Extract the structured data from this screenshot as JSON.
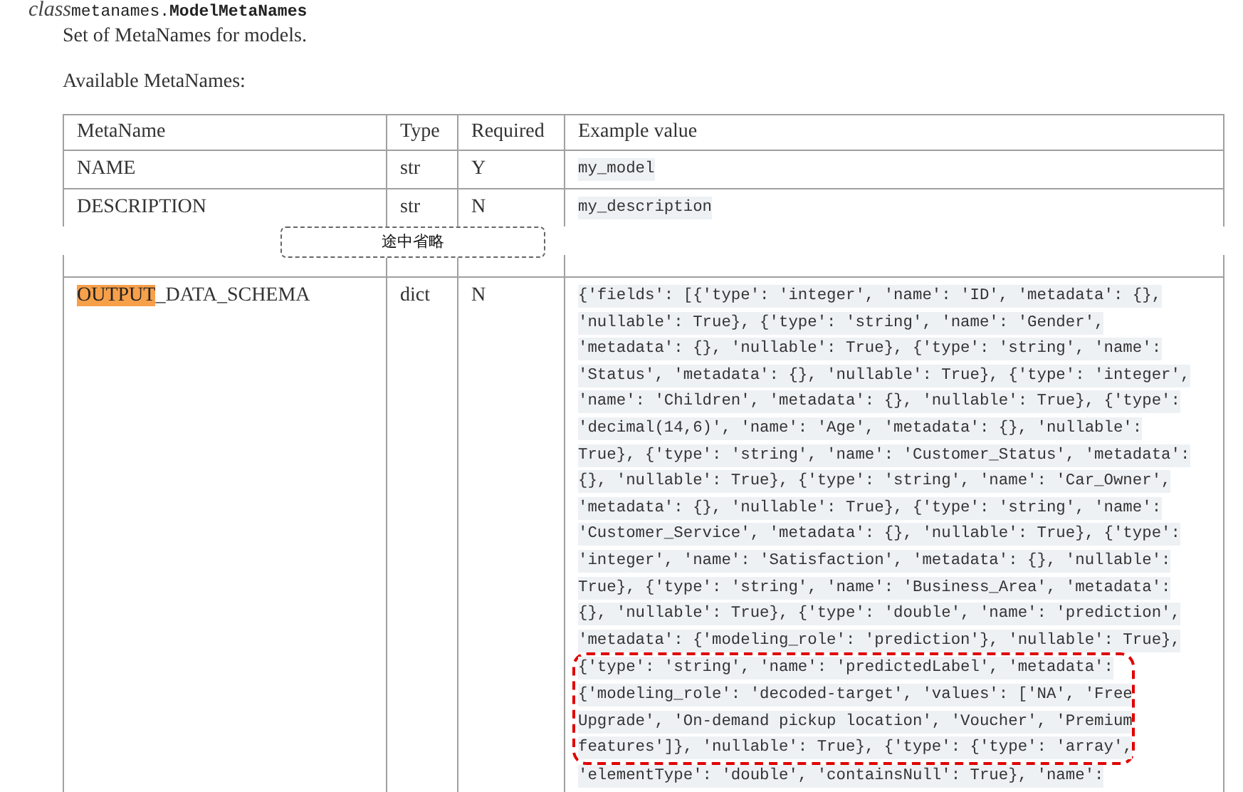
{
  "class_signature": {
    "keyword": "class",
    "module": "metanames.",
    "name": "ModelMetaNames"
  },
  "description": "Set of MetaNames for models.",
  "subheading": "Available MetaNames:",
  "table": {
    "columns": [
      "MetaName",
      "Type",
      "Required",
      "Example value"
    ],
    "rows": [
      {
        "metaname": [
          {
            "text": "NAME",
            "highlighted": false
          }
        ],
        "type": "str",
        "required": "Y",
        "example": [
          {
            "highlighted": false,
            "lines": [
              "my_model"
            ]
          }
        ]
      },
      {
        "metaname": [
          {
            "text": "DESCRIPTION",
            "highlighted": false
          }
        ],
        "type": "str",
        "required": "N",
        "example": [
          {
            "highlighted": false,
            "lines": [
              "my_description"
            ]
          }
        ]
      }
    ],
    "omission_label": "途中省略",
    "rows_after": [
      {
        "metaname": [
          {
            "text": "OUTPUT",
            "highlighted": true
          },
          {
            "text": "_DATA_SCHEMA",
            "highlighted": false
          }
        ],
        "type": "dict",
        "required": "N",
        "example": [
          {
            "highlighted": false,
            "lines": [
              "{'fields': [{'type': 'integer', 'name': 'ID', 'metadata': {},",
              "'nullable': True}, {'type': 'string', 'name': 'Gender',",
              "'metadata': {}, 'nullable': True}, {'type': 'string', 'name':",
              "'Status', 'metadata': {}, 'nullable': True}, {'type': 'integer',",
              "'name': 'Children', 'metadata': {}, 'nullable': True}, {'type':",
              "'decimal(14,6)', 'name': 'Age', 'metadata': {}, 'nullable':",
              "True}, {'type': 'string', 'name': 'Customer_Status', 'metadata':",
              "{}, 'nullable': True}, {'type': 'string', 'name': 'Car_Owner',",
              "'metadata': {}, 'nullable': True}, {'type': 'string', 'name':",
              "'Customer_Service', 'metadata': {}, 'nullable': True}, {'type':",
              "'integer', 'name': 'Satisfaction', 'metadata': {}, 'nullable':",
              "True}, {'type': 'string', 'name': 'Business_Area', 'metadata':",
              "{}, 'nullable': True}, {'type': 'double', 'name': 'prediction',",
              "'metadata': {'modeling_role': 'prediction'}, 'nullable': True},"
            ]
          },
          {
            "highlighted": true,
            "lines": [
              "{'type': 'string', 'name': 'predictedLabel', 'metadata':",
              "{'modeling_role': 'decoded-target', 'values': ['NA', 'Free",
              "Upgrade', 'On-demand pickup location', 'Voucher', 'Premium",
              "features']}, 'nullable': True}, {'type': {'type': 'array',"
            ]
          },
          {
            "highlighted": false,
            "lines": [
              "'elementType': 'double', 'containsNull': True}, 'name':"
            ]
          }
        ]
      }
    ]
  }
}
